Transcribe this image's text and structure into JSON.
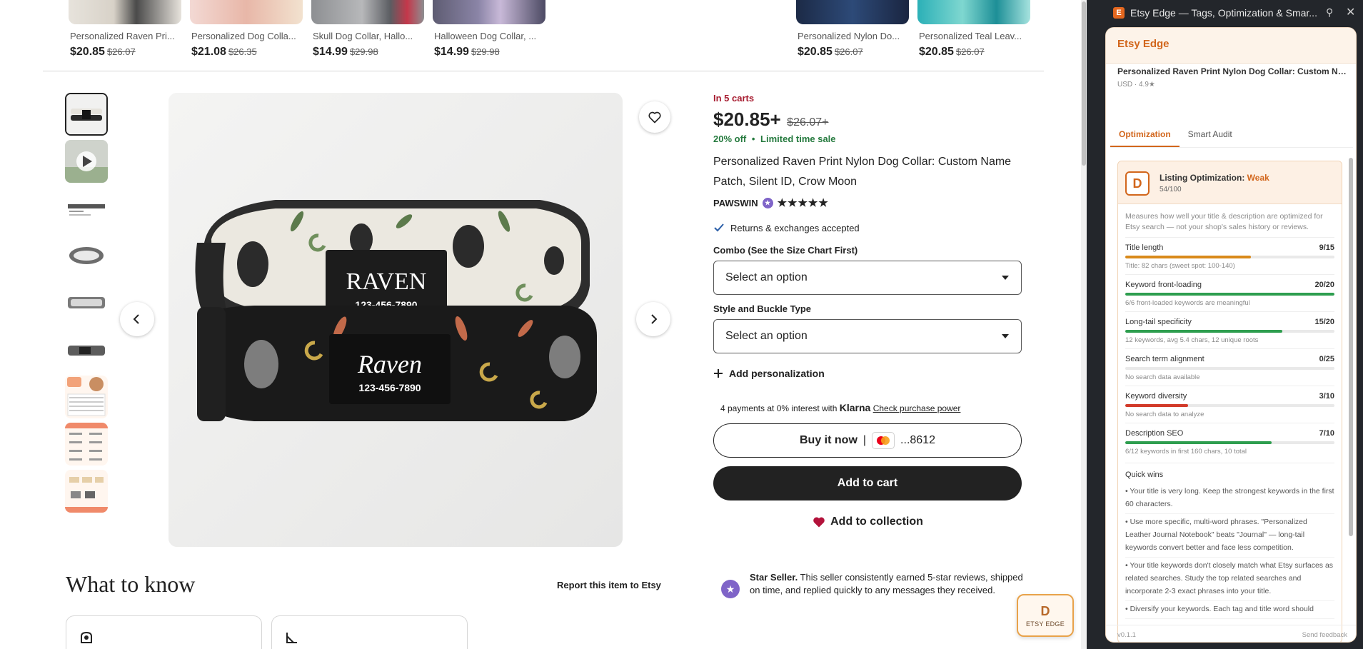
{
  "recommendations": [
    {
      "title": "Personalized Raven Pri...",
      "price": "$20.85",
      "old_price": "$26.07"
    },
    {
      "title": "Personalized Dog Colla...",
      "price": "$21.08",
      "old_price": "$26.35"
    },
    {
      "title": "Skull Dog Collar, Hallo...",
      "price": "$14.99",
      "old_price": "$29.98"
    },
    {
      "title": "Halloween Dog Collar, ...",
      "price": "$14.99",
      "old_price": "$29.98"
    },
    {
      "title": "Personalized Nylon Do...",
      "price": "$20.85",
      "old_price": "$26.07"
    },
    {
      "title": "Personalized Teal Leav...",
      "price": "$20.85",
      "old_price": "$26.07"
    }
  ],
  "product": {
    "in_carts": "In 5 carts",
    "price": "$20.85+",
    "old_price": "$26.07+",
    "discount": "20% off",
    "separator": "•",
    "sale_note": "Limited time sale",
    "title": "Personalized Raven Print Nylon Dog Collar: Custom Name Patch, Silent ID, Crow Moon",
    "shop": "PAWSWIN",
    "rating": 5,
    "returns": "Returns & exchanges accepted",
    "combo_label": "Combo (See the Size Chart First)",
    "combo_value": "Select an option",
    "style_label": "Style and Buckle Type",
    "style_value": "Select an option",
    "add_personalization": "Add personalization",
    "klarna_text": "4 payments at 0% interest with",
    "klarna_brand": "Klarna",
    "klarna_link": "Check purchase power",
    "buy_now": "Buy it now",
    "buy_divider": "|",
    "card_digits": "...8612",
    "add_to_cart": "Add to cart",
    "add_to_collection": "Add to collection"
  },
  "hero": {
    "patch_top_name": "RAVEN",
    "patch_top_phone": "123-456-7890",
    "patch_bottom_name": "Raven",
    "patch_bottom_phone": "123-456-7890"
  },
  "what_to_know": {
    "heading": "What to know",
    "report": "Report this item to Etsy"
  },
  "star_seller": {
    "lead": "Star Seller.",
    "text": "This seller consistently earned 5-star reviews, shipped on time, and replied quickly to any messages they received."
  },
  "floating_widget": {
    "letter": "D",
    "label": "ETSY EDGE"
  },
  "panel": {
    "window_title": "Etsy Edge — Tags, Optimization & Smar...",
    "favicon_letter": "E",
    "brand": "Etsy Edge",
    "listing_name": "Personalized Raven Print Nylon Dog Collar: Custom Name...",
    "listing_meta": "USD · 4.9★",
    "tabs": [
      "Optimization",
      "Smart Audit"
    ],
    "grade": "D",
    "score_label": "Listing Optimization:",
    "score_status": "Weak",
    "score": "54/100",
    "description": "Measures how well your title & description are optimized for Etsy search — not your shop's sales history or reviews.",
    "metrics": [
      {
        "name": "Title length",
        "score": "9/15",
        "fraction": 0.6,
        "color": "#d98a1a",
        "note": "Title: 82 chars (sweet spot: 100-140)"
      },
      {
        "name": "Keyword front-loading",
        "score": "20/20",
        "fraction": 1.0,
        "color": "#2e9e4f",
        "note": "6/6 front-loaded keywords are meaningful"
      },
      {
        "name": "Long-tail specificity",
        "score": "15/20",
        "fraction": 0.75,
        "color": "#2e9e4f",
        "note": "12 keywords, avg 5.4 chars, 12 unique roots"
      },
      {
        "name": "Search term alignment",
        "score": "0/25",
        "fraction": 0.0,
        "color": "#d23a2a",
        "note": "No search data available"
      },
      {
        "name": "Keyword diversity",
        "score": "3/10",
        "fraction": 0.3,
        "color": "#d23a2a",
        "note": "No search data to analyze"
      },
      {
        "name": "Description SEO",
        "score": "7/10",
        "fraction": 0.7,
        "color": "#2e9e4f",
        "note": "6/12 keywords in first 160 chars, 10 total"
      }
    ],
    "quick_wins_title": "Quick wins",
    "quick_wins": [
      "• Your title is very long. Keep the strongest keywords in the first 60 characters.",
      "• Use more specific, multi-word phrases. \"Personalized Leather Journal Notebook\" beats \"Journal\" — long-tail keywords convert better and face less competition.",
      "• Your title keywords don't closely match what Etsy surfaces as related searches. Study the top related searches and incorporate 2-3 exact phrases into your title.",
      "• Diversify your keywords. Each tag and title word should"
    ],
    "version": "v0.1.1",
    "feedback": "Send feedback"
  }
}
